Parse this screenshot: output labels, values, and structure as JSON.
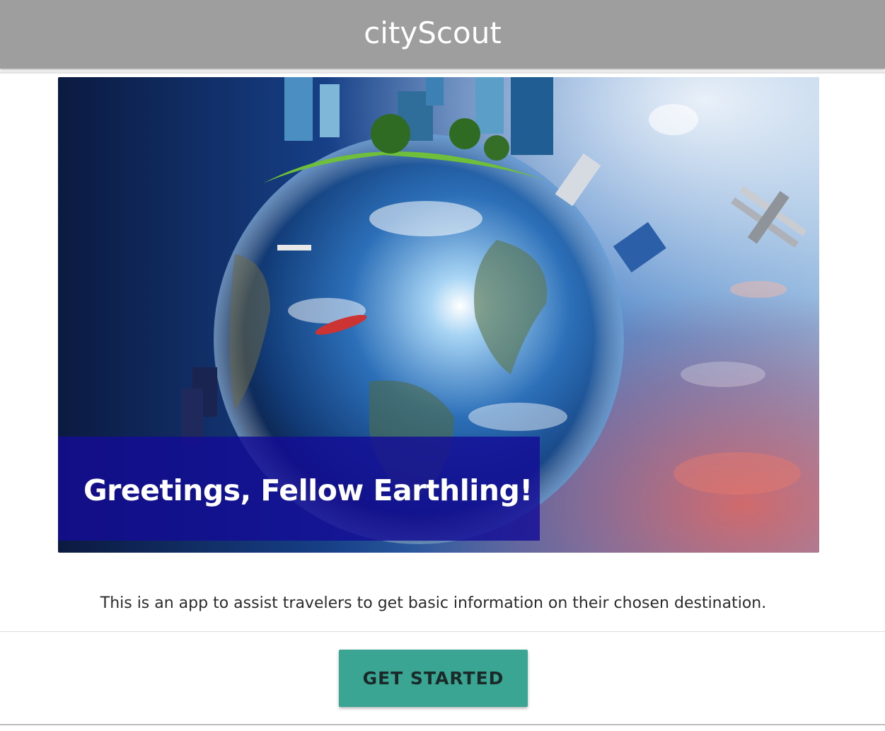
{
  "navbar": {
    "brand": "cityScout"
  },
  "hero": {
    "image_alt": "Planet Earth surrounded by city skylines, a ship, and a biplane",
    "caption": "Greetings, Fellow Earthling!"
  },
  "main": {
    "description": "This is an app to assist travelers to get basic information on their chosen destination."
  },
  "actions": {
    "get_started_label": "GET STARTED"
  },
  "colors": {
    "navbar_bg": "#9e9e9e",
    "caption_bg": "#140c96",
    "button_bg": "#3aa593"
  }
}
